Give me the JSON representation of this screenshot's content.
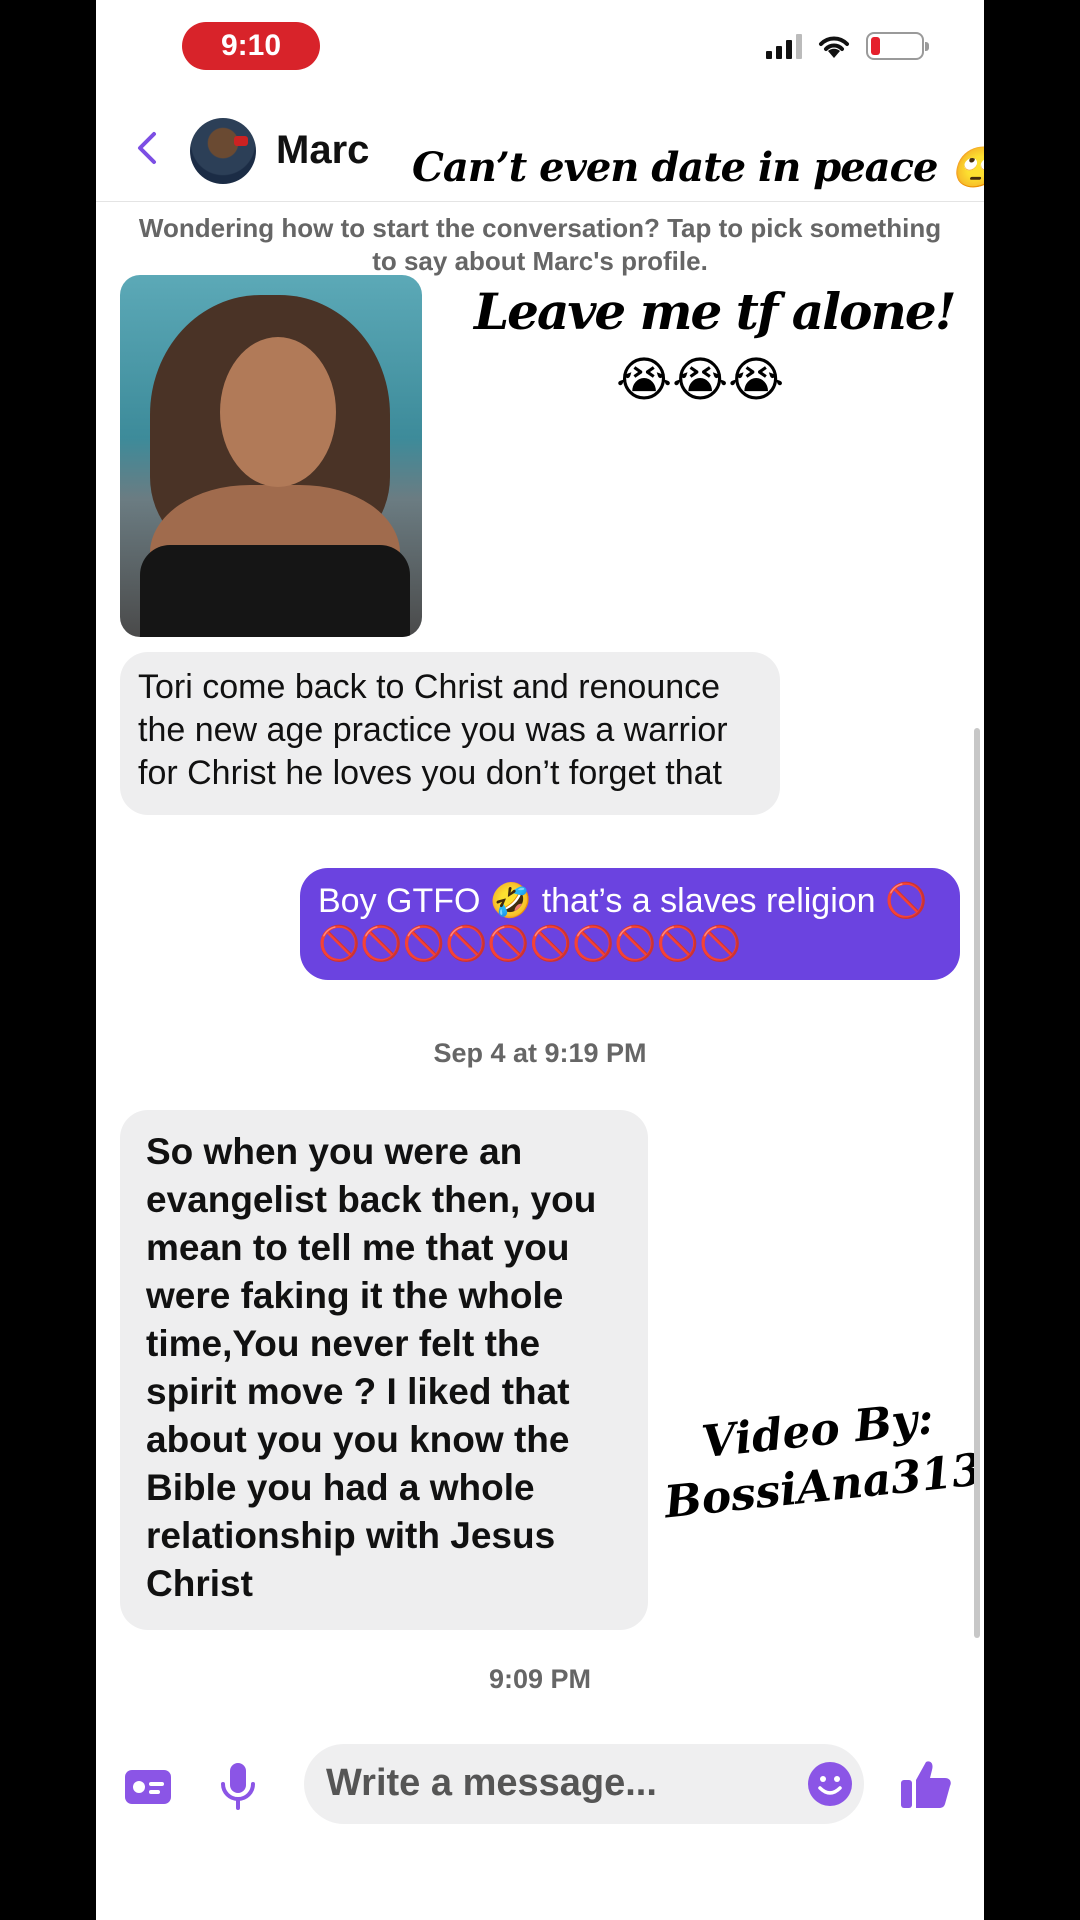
{
  "status": {
    "time": "9:10"
  },
  "header": {
    "name": "Marc",
    "overlay_title": "Can’t even date in peace 🙄"
  },
  "hint": "Wondering how to start the conversation? Tap to pick something to say about Marc's profile.",
  "overlays": {
    "leave": "Leave me tf alone!",
    "leave_emoji": "😭😭😭",
    "video_line1": "Video By:",
    "video_line2": "BossiAna313"
  },
  "messages": [
    {
      "text": "Tori come back to Christ and renounce the new age practice you was a warrior for Christ he loves you don’t forget that"
    },
    {
      "text": "Boy GTFO 🤣 that’s a slaves religion 🚫🚫🚫🚫🚫🚫🚫🚫🚫🚫🚫"
    },
    {
      "text": "So when you were an evangelist back then, you mean to tell me that you were faking it the whole time,You never felt the spirit move ? I liked that about you you know the Bible you had a whole relationship with Jesus Christ"
    }
  ],
  "timestamps": {
    "first": "Sep 4 at 9:19 PM",
    "second": "9:09 PM"
  },
  "composer": {
    "placeholder": "Write a message..."
  },
  "colors": {
    "accent": "#6b43e0",
    "icon": "#8b55e6",
    "time_pill": "#d8232a"
  },
  "icons": [
    "back-chevron-icon",
    "wifi-icon",
    "battery-icon",
    "contact-card-icon",
    "microphone-icon",
    "emoji-icon",
    "thumbs-up-icon"
  ]
}
